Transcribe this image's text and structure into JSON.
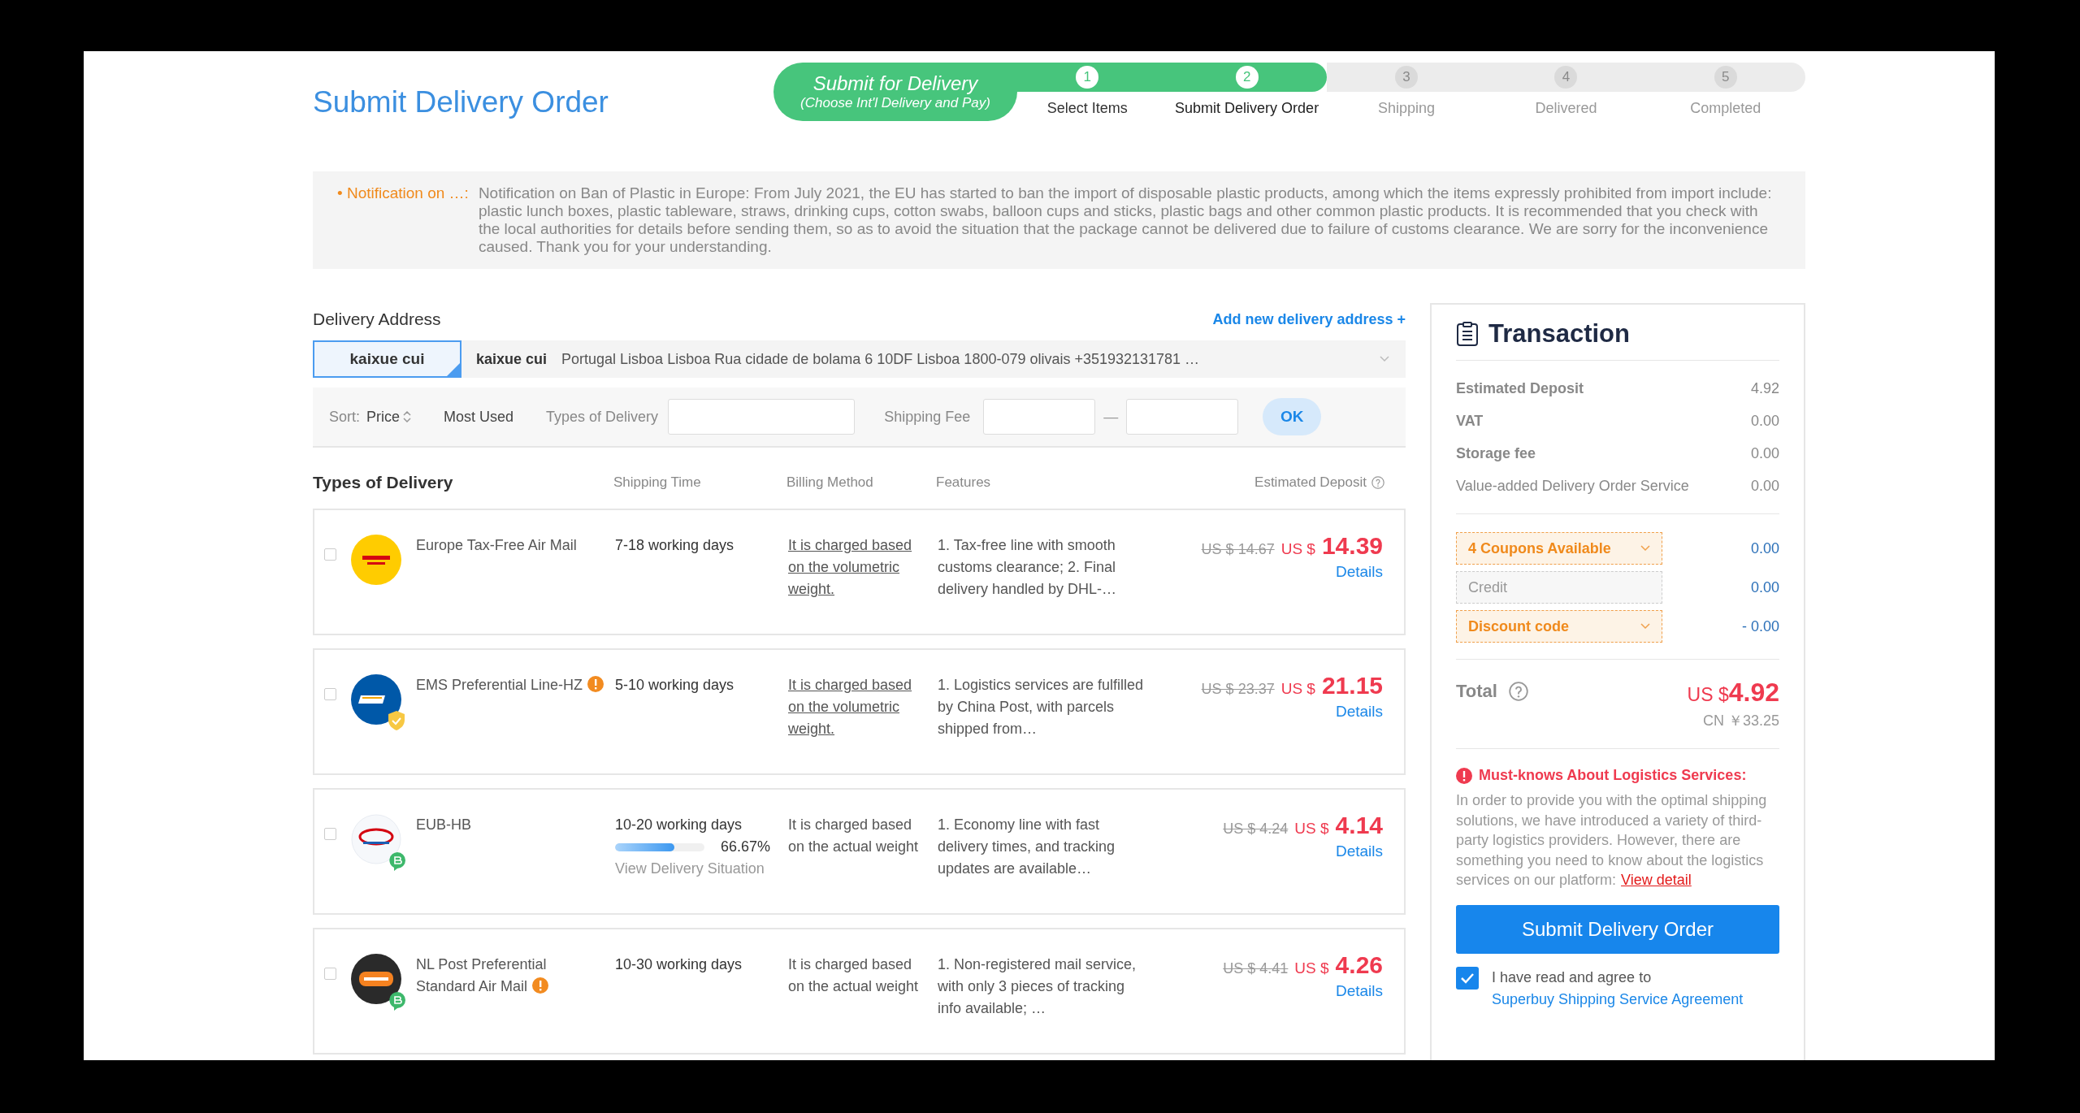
{
  "page_title": "Submit Delivery Order",
  "progress": {
    "banner_title": "Submit for Delivery",
    "banner_subtitle": "(Choose Int'l Delivery and Pay)",
    "steps": [
      {
        "number": "1",
        "label": "Select Items",
        "done": true,
        "selected": false
      },
      {
        "number": "2",
        "label": "Submit Delivery Order",
        "done": true,
        "selected": true
      },
      {
        "number": "3",
        "label": "Shipping",
        "done": false,
        "selected": false
      },
      {
        "number": "4",
        "label": "Delivered",
        "done": false,
        "selected": false
      },
      {
        "number": "5",
        "label": "Completed",
        "done": false,
        "selected": false
      }
    ]
  },
  "notification": {
    "label": "• Notification on …:",
    "text": "Notification on Ban of Plastic in Europe: From July 2021, the EU has started to ban the import of disposable plastic products, among which the items expressly prohibited from import include: plastic lunch boxes, plastic tableware, straws, drinking cups, cotton swabs, balloon cups and sticks, plastic bags and other common plastic products. It is recommended that you check with the local authorities for details before sending them, so as to avoid the situation that the package cannot be delivered due to failure of customs clearance. We are sorry for the inconvenience caused. Thank you for your understanding."
  },
  "delivery_address": {
    "heading": "Delivery Address",
    "add_link": "Add new delivery address +",
    "selected_name": "kaixue cui",
    "recipient": "kaixue cui",
    "address": "Portugal Lisboa Lisboa Rua cidade de bolama 6 10DF Lisboa 1800-079 olivais +351932131781 …"
  },
  "filters": {
    "sort_label": "Sort:",
    "sort_options": [
      {
        "label": "Price",
        "kind": "toggle"
      },
      {
        "label": "Most Used",
        "kind": "plain"
      }
    ],
    "type_label": "Types of Delivery",
    "fee_label": "Shipping Fee",
    "range_separator": "—",
    "ok": "OK"
  },
  "table": {
    "columns": [
      "Types of Delivery",
      "Shipping Time",
      "Billing Method",
      "Features",
      "Estimated Deposit"
    ],
    "rows": [
      {
        "logo": {
          "kind": "dhl"
        },
        "name": "Europe Tax-Free Air Mail",
        "warning": false,
        "checked": false,
        "shipping_time": "7-18 working days",
        "billing": "It is charged based on the volumetric weight.",
        "billing_link": true,
        "features": "1. Tax-free line with smooth customs clearance; 2. Final delivery handled by DHL-…",
        "old_price": "US $ 14.67",
        "currency": "US $",
        "price": "14.39",
        "details": "Details"
      },
      {
        "logo": {
          "kind": "ems"
        },
        "badge": {
          "kind": "shield"
        },
        "name": "EMS Preferential Line-HZ",
        "warning": true,
        "checked": false,
        "shipping_time": "5-10 working days",
        "billing": "It is charged based on the volumetric weight.",
        "billing_link": true,
        "features": "1. Logistics services are fulfilled by China Post, with parcels shipped from…",
        "old_price": "US $ 23.37",
        "currency": "US $",
        "price": "21.15",
        "details": "Details"
      },
      {
        "logo": {
          "kind": "eub"
        },
        "badge": {
          "kind": "leaf"
        },
        "name": "EUB-HB",
        "warning": false,
        "checked": false,
        "shipping_time": "10-20 working days",
        "on_time": {
          "level": 0.6667,
          "reading": "66.67%",
          "link": "View Delivery Situation"
        },
        "billing": "It is charged based on the actual weight",
        "billing_link": false,
        "features": "1. Economy line with fast delivery times, and tracking updates are available…",
        "old_price": "US $ 4.24",
        "currency": "US $",
        "price": "4.14",
        "details": "Details"
      },
      {
        "logo": {
          "kind": "postnl"
        },
        "badge": {
          "kind": "leaf"
        },
        "name": "NL Post Preferential Standard Air Mail",
        "warning": true,
        "checked": false,
        "shipping_time": "10-30 working days",
        "billing": "It is charged based on the actual weight",
        "billing_link": false,
        "features": "1. Non-registered mail service, with only 3 pieces of tracking info available; …",
        "old_price": "US $ 4.41",
        "currency": "US $",
        "price": "4.26",
        "details": "Details"
      }
    ]
  },
  "transaction": {
    "title": "Transaction",
    "fees": [
      {
        "label": "Estimated Deposit",
        "value": "4.92"
      },
      {
        "label": "VAT",
        "value": "0.00"
      },
      {
        "label": "Storage fee",
        "value": "0.00"
      },
      {
        "label": "Value-added Delivery Order Service",
        "value": "0.00"
      }
    ],
    "discounts": [
      {
        "label": "4 Coupons Available",
        "kind": "dropdown",
        "value": "0.00"
      },
      {
        "label": "Credit",
        "kind": "field",
        "value": "0.00"
      },
      {
        "label": "Discount code",
        "kind": "dropdown",
        "value": "- 0.00"
      }
    ],
    "total_label": "Total",
    "total_currency": "US $",
    "total": "4.92",
    "total_cny": "CN ￥33.25",
    "notice_title": "Must-knows About Logistics Services:",
    "notice_text": "In order to provide you with the optimal shipping solutions, we have introduced a variety of third-party logistics providers. However, there are something you need to know about the logistics services on our platform:",
    "notice_link": "View detail",
    "submit": "Submit Delivery Order",
    "agree_checked": true,
    "agree_text": "I have read and agree to",
    "agree_link": "Superbuy Shipping Service Agreement"
  }
}
